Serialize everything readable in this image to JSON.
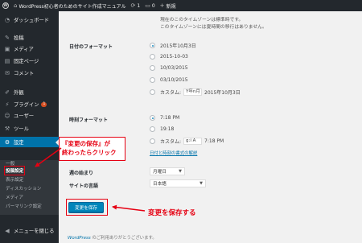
{
  "adminbar": {
    "site_title": "WordPress初心者のためのサイト作成マニュアル",
    "updates_count": "1",
    "comments_count": "0",
    "new_label": "新規"
  },
  "sidebar": {
    "items": [
      {
        "label": "ダッシュボード",
        "icon": "dashboard-icon"
      },
      {
        "label": "投稿",
        "icon": "pin-icon"
      },
      {
        "label": "メディア",
        "icon": "media-icon"
      },
      {
        "label": "固定ページ",
        "icon": "page-icon"
      },
      {
        "label": "コメント",
        "icon": "comment-icon"
      },
      {
        "label": "外観",
        "icon": "brush-icon"
      },
      {
        "label": "プラグイン",
        "icon": "plugin-icon",
        "badge": "1"
      },
      {
        "label": "ユーザー",
        "icon": "user-icon"
      },
      {
        "label": "ツール",
        "icon": "wrench-icon"
      },
      {
        "label": "設定",
        "icon": "settings-icon"
      }
    ],
    "submenu": [
      "一般",
      "投稿設定",
      "表示設定",
      "ディスカッション",
      "メディア",
      "パーマリンク設定"
    ],
    "collapse_label": "メニューを閉じる"
  },
  "main": {
    "tz_note_1": "現在のこのタイムゾーンは標準時です。",
    "tz_note_2": "このタイムゾーンには夏時間の移行はありません。",
    "date_format_label": "日付のフォーマット",
    "date_options": [
      "2015年10月3日",
      "2015-10-03",
      "10/03/2015",
      "03/10/2015"
    ],
    "custom_label": "カスタム:",
    "date_custom_value": "Y年n月",
    "date_custom_preview": "2015年10月3日",
    "time_format_label": "時刻フォーマット",
    "time_options": [
      "7:18 PM",
      "19:18"
    ],
    "time_custom_value": "g:i A",
    "time_custom_preview": "7:18 PM",
    "doc_link": "日付と時刻の書式の解説",
    "week_start_label": "週の始まり",
    "week_start_value": "月曜日",
    "language_label": "サイトの言語",
    "language_value": "日本語",
    "save_label": "変更を保存",
    "footer_wp": "WordPress",
    "footer_text": " のご利用ありがとうございます。"
  },
  "annotations": {
    "box_line1": "『変更の保存』が",
    "box_line2": "終わったらクリック",
    "save_note": "変更を保存する",
    "color": "#e60012"
  },
  "colors": {
    "sidebar_bg": "#23282d",
    "accent": "#0073aa",
    "button": "#0085ba",
    "badge": "#d54e21"
  }
}
